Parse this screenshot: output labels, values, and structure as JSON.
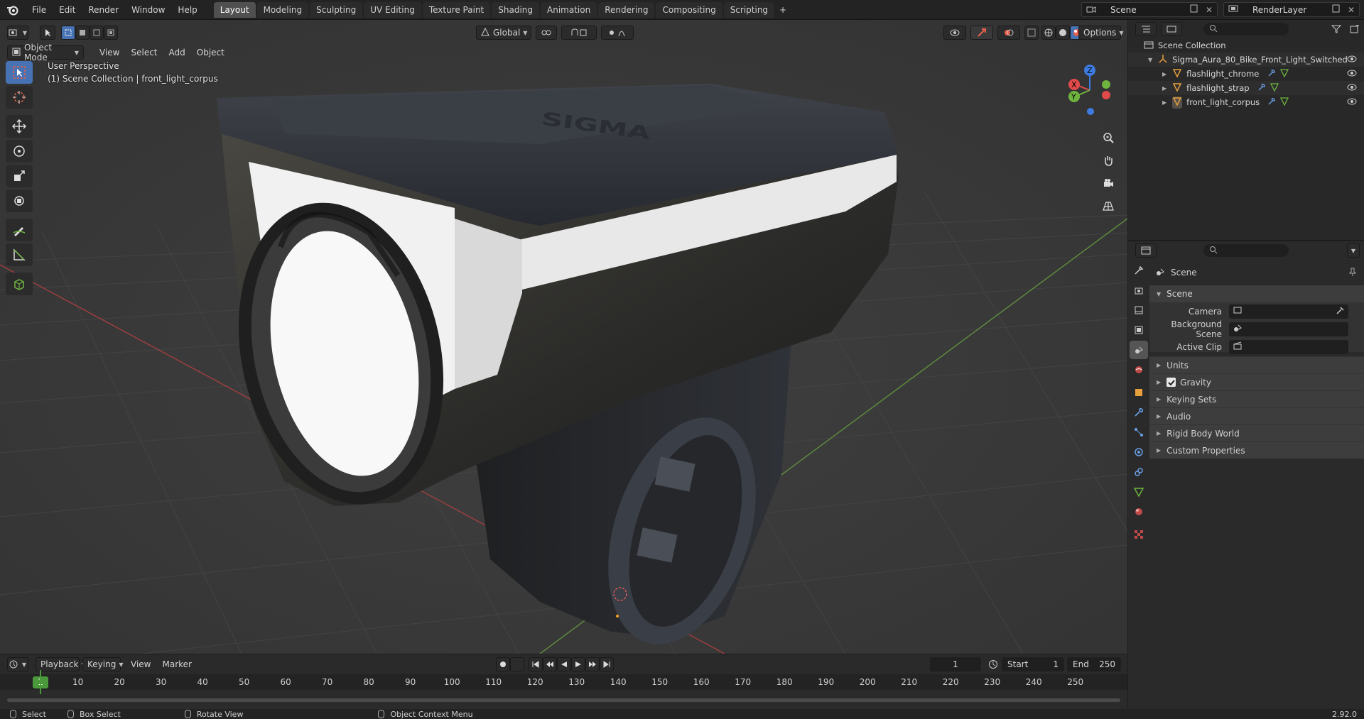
{
  "top_menu": [
    "File",
    "Edit",
    "Render",
    "Window",
    "Help"
  ],
  "workspaces": [
    "Layout",
    "Modeling",
    "Sculpting",
    "UV Editing",
    "Texture Paint",
    "Shading",
    "Animation",
    "Rendering",
    "Compositing",
    "Scripting"
  ],
  "active_workspace": "Layout",
  "workspace_add": "+",
  "scene_name": "Scene",
  "view_layer": "RenderLayer",
  "viewport": {
    "mode": "Object Mode",
    "menus": [
      "View",
      "Select",
      "Add",
      "Object"
    ],
    "orientation": "Global",
    "options": "Options",
    "perspective": "User Perspective",
    "context": "(1) Scene Collection | front_light_corpus",
    "gizmo_axes": {
      "x": "X",
      "y": "Y",
      "z": "Z"
    },
    "logo_text": "SIGMA"
  },
  "outliner": {
    "root": "Scene Collection",
    "collection": "Sigma_Aura_80_Bike_Front_Light_Switched",
    "objects": [
      "flashlight_chrome",
      "flashlight_strap",
      "front_light_corpus"
    ]
  },
  "properties": {
    "context_title": "Scene",
    "panel_title": "Scene",
    "fields": [
      {
        "label": "Camera"
      },
      {
        "label": "Background Scene"
      },
      {
        "label": "Active Clip"
      }
    ],
    "subpanels": [
      "Units",
      "Gravity",
      "Keying Sets",
      "Audio",
      "Rigid Body World",
      "Custom Properties"
    ],
    "gravity_checked": true
  },
  "timeline": {
    "menus": [
      "Playback",
      "Keying",
      "View",
      "Marker"
    ],
    "current_frame": "1",
    "start_label": "Start",
    "start_value": "1",
    "end_label": "End",
    "end_value": "250",
    "ticks": [
      "1",
      "10",
      "20",
      "30",
      "40",
      "50",
      "60",
      "70",
      "80",
      "90",
      "100",
      "110",
      "120",
      "130",
      "140",
      "150",
      "160",
      "170",
      "180",
      "190",
      "200",
      "210",
      "220",
      "230",
      "240",
      "250"
    ]
  },
  "statusbar": {
    "items": [
      "Select",
      "Box Select",
      "Rotate View",
      "Object Context Menu"
    ],
    "version": "2.92.0"
  },
  "colors": {
    "accent": "#4772b3",
    "frame_cursor": "#4a9a3c",
    "axis_x": "#e04a4a",
    "axis_y": "#6fb43f",
    "axis_z": "#3d7be0"
  }
}
